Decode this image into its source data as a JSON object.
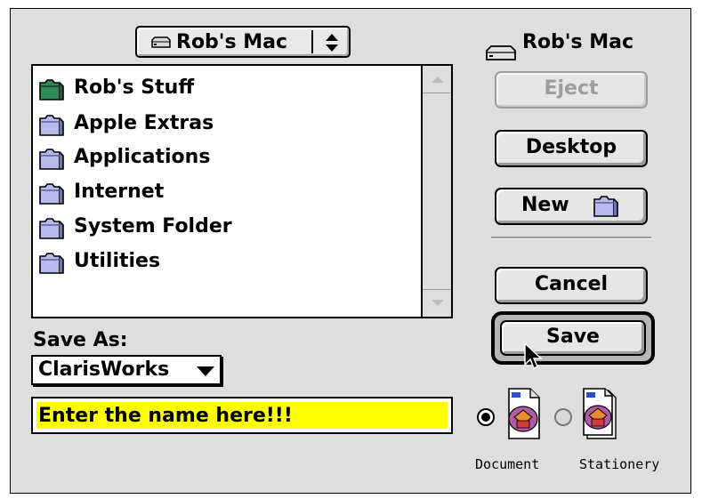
{
  "dialog": {
    "volume_popup": {
      "label": "Rob's Mac",
      "icon": "hard-disk-icon",
      "arrows_icon": "up-down-arrows-icon"
    },
    "volume_name": {
      "label": "Rob's Mac",
      "icon": "hard-disk-icon"
    },
    "file_list": {
      "items": [
        {
          "label": "Rob's Stuff",
          "icon": "green-folder-icon"
        },
        {
          "label": "Apple Extras",
          "icon": "folder-icon"
        },
        {
          "label": "Applications",
          "icon": "folder-icon"
        },
        {
          "label": "Internet",
          "icon": "folder-icon"
        },
        {
          "label": "System Folder",
          "icon": "folder-icon"
        },
        {
          "label": "Utilities",
          "icon": "folder-icon"
        }
      ]
    },
    "buttons": {
      "eject": "Eject",
      "desktop": "Desktop",
      "new": "New",
      "cancel": "Cancel",
      "save": "Save"
    },
    "save_as": {
      "label": "Save As:",
      "format": "ClarisWorks"
    },
    "name_field": {
      "value": "Enter the name here!!!",
      "highlight_color": "#ffff00"
    },
    "file_type": {
      "document_label": "Document",
      "stationery_label": "Stationery",
      "selected": "Document"
    }
  }
}
